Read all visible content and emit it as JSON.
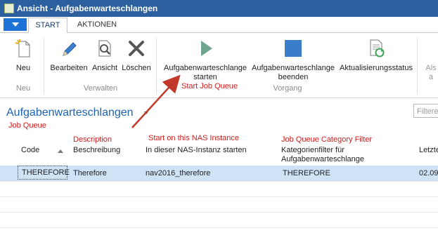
{
  "window": {
    "title": "Ansicht - Aufgabenwarteschlangen"
  },
  "tabs": [
    {
      "label": "START"
    },
    {
      "label": "AKTIONEN"
    }
  ],
  "ribbon": {
    "buttons": {
      "neu": "Neu",
      "bearbeiten": "Bearbeiten",
      "ansicht": "Ansicht",
      "loeschen": "Löschen",
      "starten_line1": "Aufgabenwarteschlange",
      "starten_line2": "starten",
      "beenden_line1": "Aufgabenwarteschlange",
      "beenden_line2": "beenden",
      "status": "Aktualisierungsstatus",
      "als_line1": "Als",
      "als_line2": "a"
    },
    "groups": {
      "neu": "Neu",
      "verwalten": "Verwalten",
      "vorgang": "Vorgang"
    }
  },
  "annotations": {
    "start_job_queue": "Start Job Queue",
    "job_queue": "Job Queue",
    "description": "Description",
    "start_nas": "Start on this NAS Instance",
    "category_filter": "Job Queue Category Filter",
    "color": "#d01c1c"
  },
  "page": {
    "title": "Aufgabenwarteschlangen",
    "filter_placeholder": "Filtere"
  },
  "table": {
    "headers": {
      "code": "Code",
      "beschreibung": "Beschreibung",
      "nas": "In dieser NAS-Instanz starten",
      "kategorie_line1": "Kategorienfilter für",
      "kategorie_line2": "Aufgabenwarteschlange",
      "letzte": "Letzte"
    },
    "rows": [
      {
        "code": "THEREFORE",
        "beschreibung": "Therefore",
        "nas": "nav2016_therefore",
        "kategorie": "THEREFORE",
        "letzte": "02.09"
      }
    ]
  },
  "colors": {
    "titlebar": "#2c5f9e",
    "app_menu": "#1f73d6",
    "page_title": "#1d62b2",
    "selected_row": "#cfe3f7",
    "start_icon": "#6fa58c",
    "stop_icon": "#3a7dc9"
  },
  "icons": [
    "new-document-icon",
    "pencil-icon",
    "magnifier-document-icon",
    "delete-x-icon",
    "play-icon",
    "stop-icon",
    "refresh-document-icon"
  ]
}
